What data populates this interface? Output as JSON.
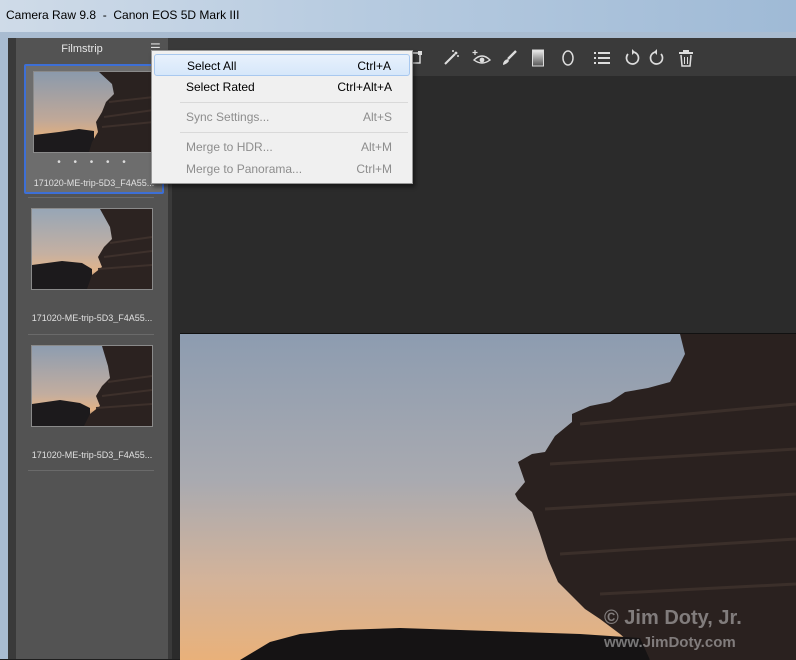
{
  "window": {
    "title": "Camera Raw 9.8  -  Canon EOS 5D Mark III"
  },
  "filmstrip": {
    "title": "Filmstrip",
    "items": [
      {
        "name": "171020-ME-trip-5D3_F4A55...",
        "rating_dots": "• • • • •",
        "selected": true
      },
      {
        "name": "171020-ME-trip-5D3_F4A55...",
        "selected": false
      },
      {
        "name": "171020-ME-trip-5D3_F4A55...",
        "selected": false
      }
    ]
  },
  "menu": {
    "items": [
      {
        "label": "Select All",
        "shortcut": "Ctrl+A",
        "enabled": true,
        "highlighted": true
      },
      {
        "label": "Select Rated",
        "shortcut": "Ctrl+Alt+A",
        "enabled": true
      },
      {
        "label": "Sync Settings...",
        "shortcut": "Alt+S",
        "enabled": false
      },
      {
        "label": "Merge to HDR...",
        "shortcut": "Alt+M",
        "enabled": false
      },
      {
        "label": "Merge to Panorama...",
        "shortcut": "Ctrl+M",
        "enabled": false
      }
    ]
  },
  "toolbar": {
    "icons": [
      "transform-icon",
      "spot-removal-icon",
      "red-eye-icon",
      "adjustment-brush-icon",
      "graduated-filter-icon",
      "radial-filter-icon",
      "preferences-list-icon",
      "rotate-left-icon",
      "rotate-right-icon",
      "trash-icon"
    ]
  },
  "watermark": {
    "line1": "© Jim Doty, Jr.",
    "line2": "www.JimDoty.com"
  }
}
